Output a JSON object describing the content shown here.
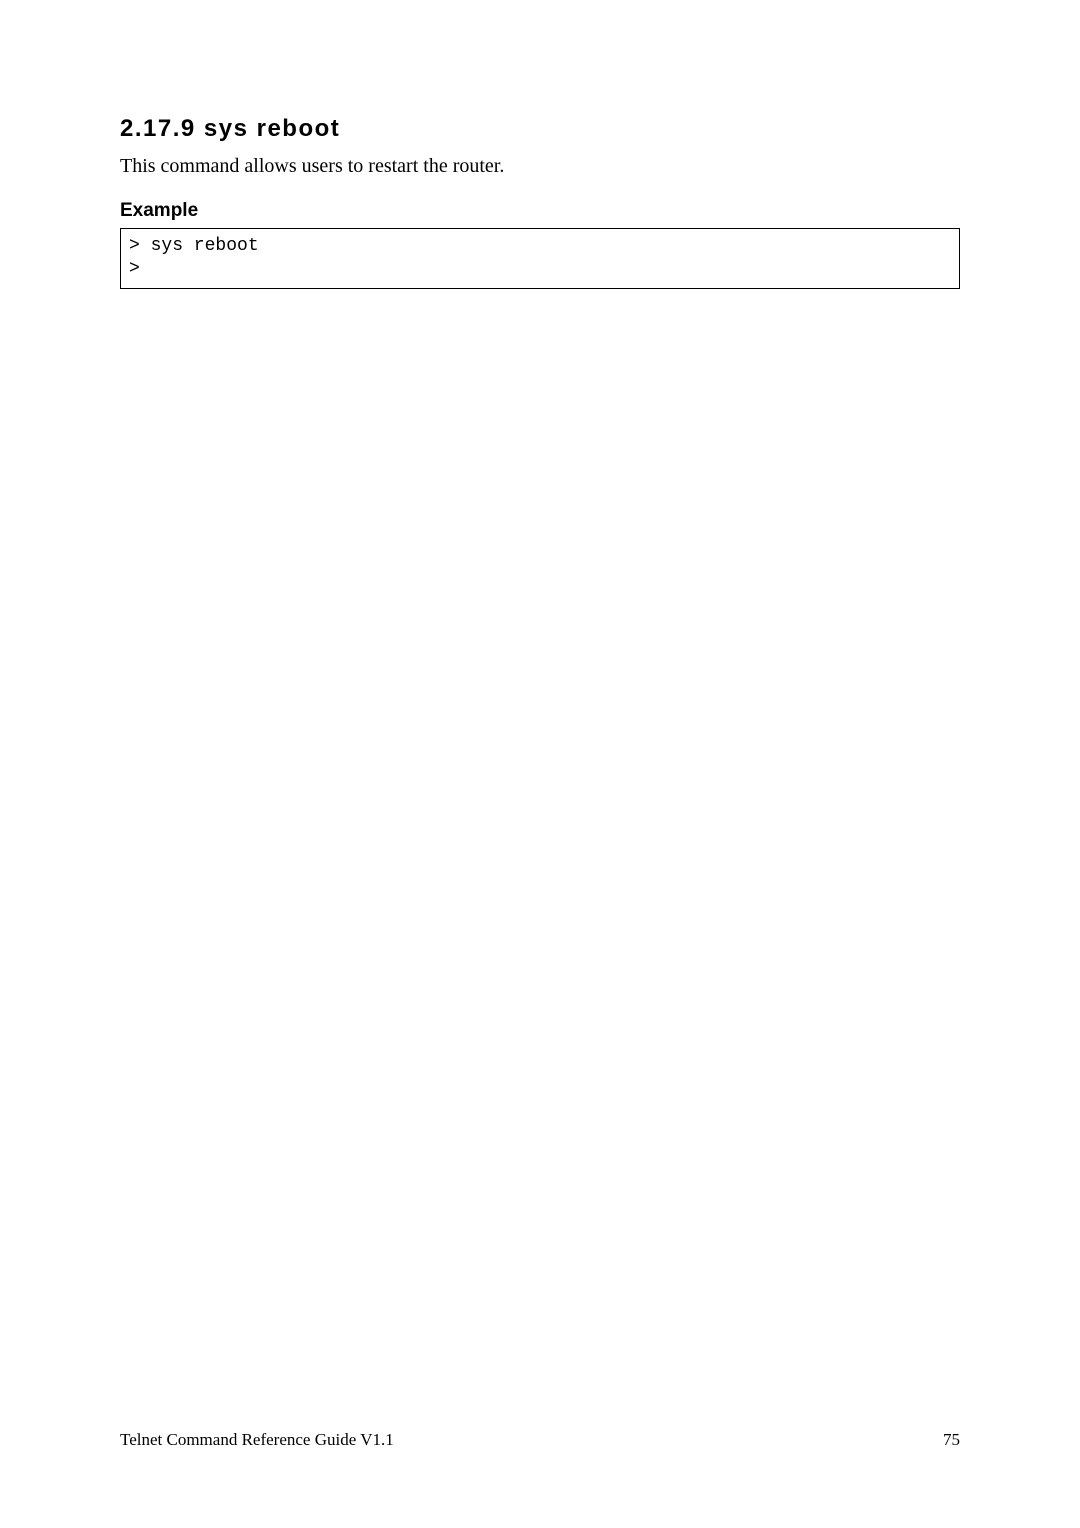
{
  "section": {
    "heading": "2.17.9 sys reboot",
    "description": "This command allows users to restart the router.",
    "example_label": "Example",
    "code": "> sys reboot \n>"
  },
  "footer": {
    "guide_title": "Telnet Command Reference Guide V1.1",
    "page_number": "75"
  }
}
